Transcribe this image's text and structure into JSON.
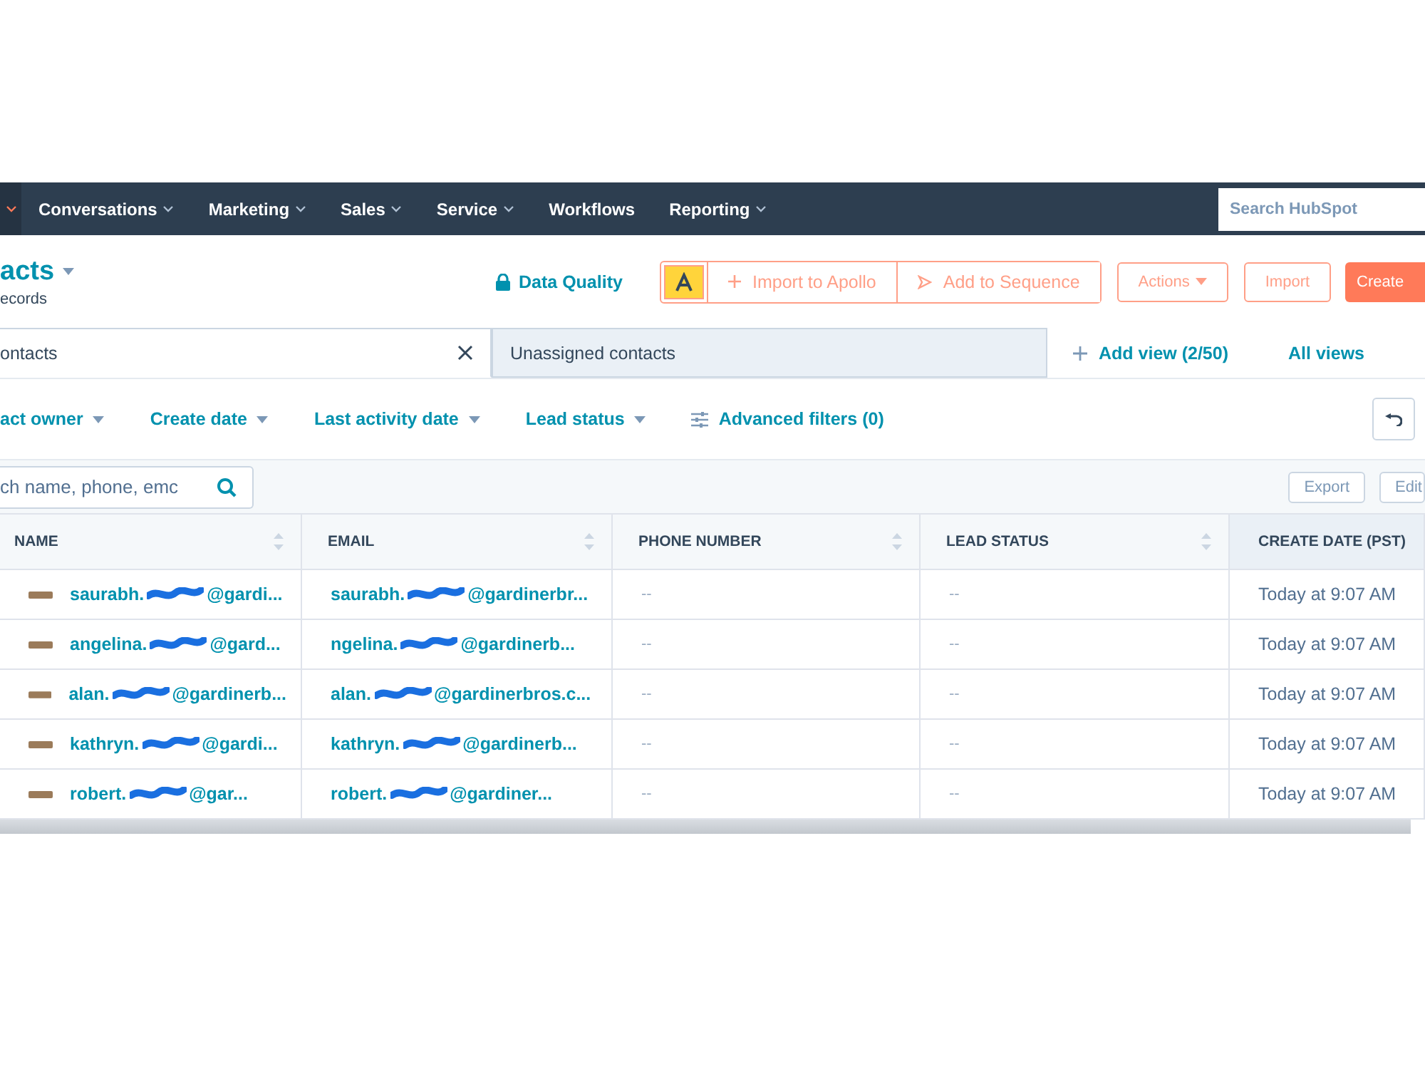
{
  "nav": {
    "items": [
      {
        "label": "Conversations",
        "has_menu": true
      },
      {
        "label": "Marketing",
        "has_menu": true
      },
      {
        "label": "Sales",
        "has_menu": true
      },
      {
        "label": "Service",
        "has_menu": true
      },
      {
        "label": "Workflows",
        "has_menu": false
      },
      {
        "label": "Reporting",
        "has_menu": true
      }
    ],
    "search": {
      "placeholder": "Search HubSpot"
    }
  },
  "header": {
    "title": "acts",
    "subtitle": "ecords",
    "data_quality": "Data Quality",
    "apollo_buttons": [
      "Import to Apollo",
      "Add to Sequence"
    ],
    "actions": "Actions",
    "import": "Import",
    "create": "Create"
  },
  "tabs": [
    {
      "label": "ontacts",
      "selected": true,
      "closable": true
    },
    {
      "label": "Unassigned contacts",
      "selected": false,
      "closable": false
    }
  ],
  "add_view": "Add view (2/50)",
  "all_views": "All views",
  "filters": [
    {
      "label": "act owner",
      "kind": "dropdown"
    },
    {
      "label": "Create date",
      "kind": "dropdown"
    },
    {
      "label": "Last activity date",
      "kind": "dropdown"
    },
    {
      "label": "Lead status",
      "kind": "dropdown"
    },
    {
      "label": "Advanced filters (0)",
      "kind": "advanced"
    }
  ],
  "table_search": {
    "placeholder": "ch name, phone, emc"
  },
  "table_buttons": [
    "Export",
    "Edit"
  ],
  "table": {
    "columns": [
      {
        "label": "NAME",
        "sortable": true
      },
      {
        "label": "EMAIL",
        "sortable": true
      },
      {
        "label": "PHONE NUMBER",
        "sortable": true
      },
      {
        "label": "LEAD STATUS",
        "sortable": true
      },
      {
        "label": "CREATE DATE (PST)",
        "sortable": false
      }
    ],
    "rows": [
      {
        "name": [
          "saurabh.",
          "@gardi..."
        ],
        "email": [
          "saurabh.",
          "@gardinerbr..."
        ],
        "phone": "--",
        "lead_status": "--",
        "create_date": "Today at 9:07 AM"
      },
      {
        "name": [
          "angelina.",
          "@gard..."
        ],
        "email": [
          "ngelina.",
          "@gardinerb..."
        ],
        "phone": "--",
        "lead_status": "--",
        "create_date": "Today at 9:07 AM"
      },
      {
        "name": [
          "alan.",
          "@gardinerb..."
        ],
        "email": [
          "alan.",
          "@gardinerbros.c..."
        ],
        "phone": "--",
        "lead_status": "--",
        "create_date": "Today at 9:07 AM"
      },
      {
        "name": [
          "kathryn.",
          "@gardi..."
        ],
        "email": [
          "kathryn.",
          "@gardinerb..."
        ],
        "phone": "--",
        "lead_status": "--",
        "create_date": "Today at 9:07 AM"
      },
      {
        "name": [
          "robert.",
          "@gar..."
        ],
        "email": [
          "robert.",
          "@gardiner..."
        ],
        "phone": "--",
        "lead_status": "--",
        "create_date": "Today at 9:07 AM"
      }
    ]
  }
}
